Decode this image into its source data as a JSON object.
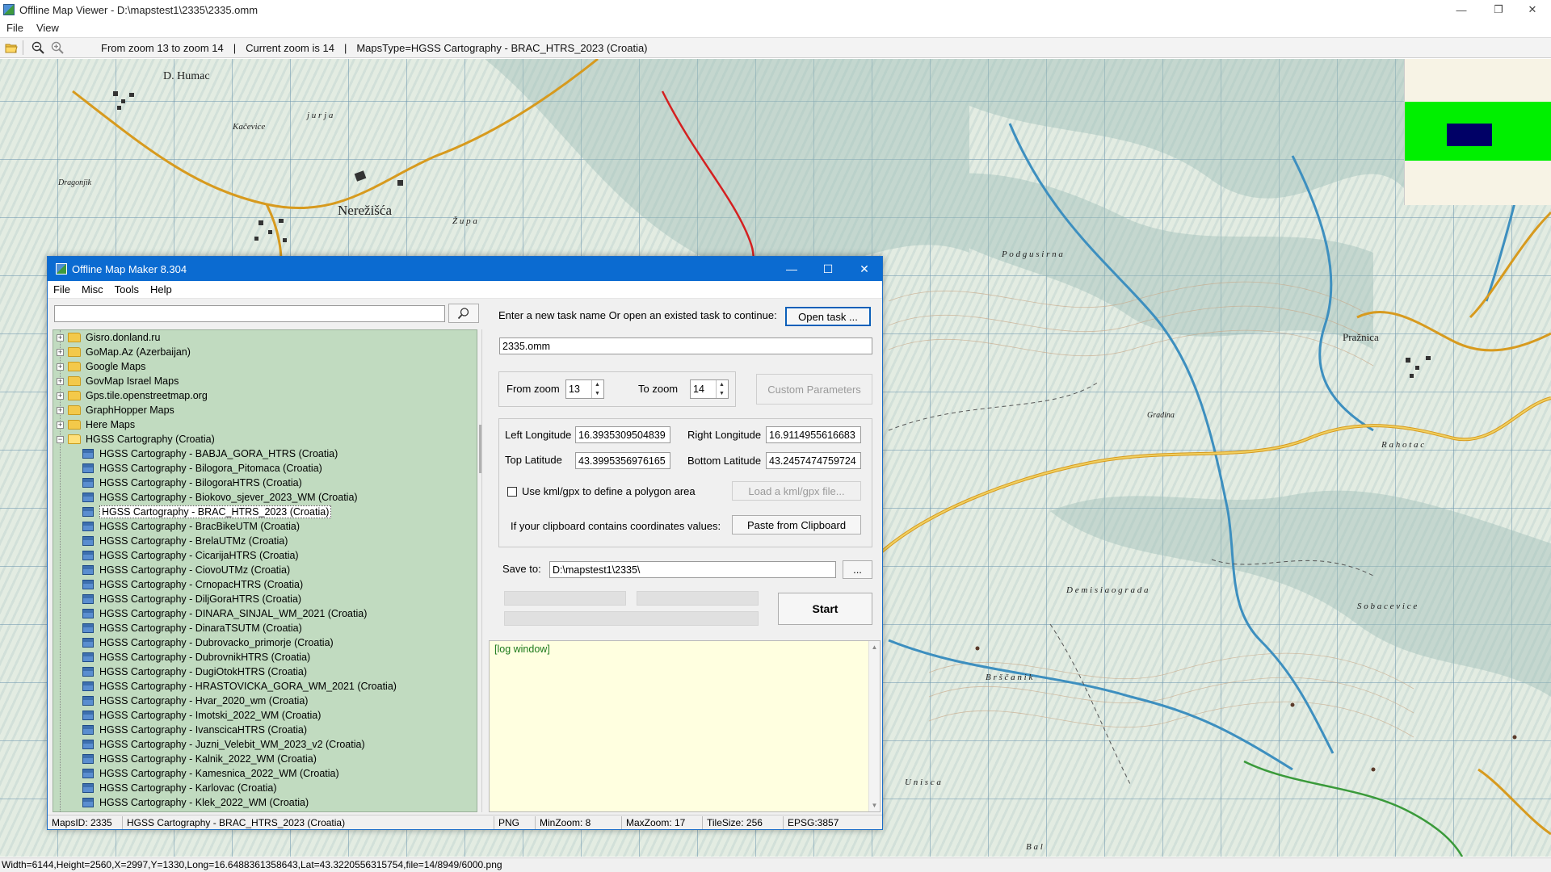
{
  "window": {
    "title": "Offline Map Viewer - D:\\mapstest1\\2335\\2335.omm",
    "controls": {
      "minimize": "—",
      "restore": "❐",
      "close": "✕"
    }
  },
  "menu": [
    "File",
    "View"
  ],
  "toolbar": {
    "zoom_range": "From zoom 13 to zoom 14",
    "current_zoom": "Current zoom is 14",
    "maps_type": "MapsType=HGSS Cartography - BRAC_HTRS_2023 (Croatia)",
    "separator": "|"
  },
  "map": {
    "labels": {
      "humac": "D. Humac",
      "nerezisca": "Nerežišća",
      "praznica": "Pražnica",
      "kacevice": "Kačevice",
      "dragonjik": "Dragonjik",
      "jurja": "j u r j a",
      "zupa": "Ž u p a",
      "podgusirna": "P o d g u s i r n a",
      "demisia": "D e m i s i a   o g r a d a",
      "brscanik": "B r š č a n i k",
      "unisca": "U n i s c a",
      "sobacevice": "S o b a c e v i c e",
      "rahotac": "R a h o t a c",
      "gradina": "Gradina",
      "bal": "B a l"
    }
  },
  "status": "Width=6144,Height=2560,X=2997,Y=1330,Long=16.6488361358643,Lat=43.3220556315754,file=14/8949/6000.png",
  "dialog": {
    "title": "Offline Map Maker 8.304",
    "menu": [
      "File",
      "Misc",
      "Tools",
      "Help"
    ],
    "search_value": "",
    "tree": {
      "folders": [
        {
          "label": "Gisro.donland.ru",
          "expanded": false
        },
        {
          "label": "GoMap.Az (Azerbaijan)",
          "expanded": false
        },
        {
          "label": "Google Maps",
          "expanded": false
        },
        {
          "label": "GovMap Israel Maps",
          "expanded": false
        },
        {
          "label": "Gps.tile.openstreetmap.org",
          "expanded": false
        },
        {
          "label": "GraphHopper Maps",
          "expanded": false
        },
        {
          "label": "Here Maps",
          "expanded": false
        },
        {
          "label": "HGSS Cartography (Croatia)",
          "expanded": true
        }
      ],
      "children": [
        "HGSS Cartography - BABJA_GORA_HTRS (Croatia)",
        "HGSS Cartography - Bilogora_Pitomaca (Croatia)",
        "HGSS Cartography - BilogoraHTRS (Croatia)",
        "HGSS Cartography - Biokovo_sjever_2023_WM (Croatia)",
        "HGSS Cartography - BRAC_HTRS_2023 (Croatia)",
        "HGSS Cartography - BracBikeUTM (Croatia)",
        "HGSS Cartography - BrelaUTMz (Croatia)",
        "HGSS Cartography - CicarijaHTRS (Croatia)",
        "HGSS Cartography - CiovoUTMz (Croatia)",
        "HGSS Cartography - CrnopacHTRS (Croatia)",
        "HGSS Cartography - DiljGoraHTRS (Croatia)",
        "HGSS Cartography - DINARA_SINJAL_WM_2021 (Croatia)",
        "HGSS Cartography - DinaraTSUTM (Croatia)",
        "HGSS Cartography - Dubrovacko_primorje (Croatia)",
        "HGSS Cartography - DubrovnikHTRS (Croatia)",
        "HGSS Cartography - DugiOtokHTRS (Croatia)",
        "HGSS Cartography - HRASTOVICKA_GORA_WM_2021 (Croatia)",
        "HGSS Cartography - Hvar_2020_wm (Croatia)",
        "HGSS Cartography - Imotski_2022_WM (Croatia)",
        "HGSS Cartography - IvanscicaHTRS (Croatia)",
        "HGSS Cartography - Juzni_Velebit_WM_2023_v2 (Croatia)",
        "HGSS Cartography - Kalnik_2022_WM (Croatia)",
        "HGSS Cartography - Kamesnica_2022_WM (Croatia)",
        "HGSS Cartography - Karlovac (Croatia)",
        "HGSS Cartography - Klek_2022_WM (Croatia)"
      ],
      "selected_index": 4
    },
    "task_prompt": "Enter a new task name Or open an existed task to continue:",
    "open_task_label": "Open task ...",
    "task_name": "2335.omm",
    "from_zoom_label": "From zoom",
    "from_zoom": "13",
    "to_zoom_label": "To zoom",
    "to_zoom": "14",
    "custom_params_label": "Custom Parameters",
    "left_lon_label": "Left Longitude",
    "left_lon": "16.3935309504839",
    "right_lon_label": "Right Longitude",
    "right_lon": "16.9114955616683",
    "top_lat_label": "Top Latitude",
    "top_lat": "43.3995356976165",
    "bottom_lat_label": "Bottom Latitude",
    "bottom_lat": "43.2457474759724",
    "kml_label": "Use kml/gpx to define a polygon area",
    "load_kml_label": "Load a kml/gpx file...",
    "clipboard_label": "If your clipboard contains coordinates values:",
    "paste_label": "Paste from Clipboard",
    "save_to_label": "Save to:",
    "save_to": "D:\\mapstest1\\2335\\",
    "browse_label": "...",
    "start_label": "Start",
    "log_text": "[log window]",
    "status": {
      "maps_id": "MapsID: 2335",
      "maps_name": "HGSS Cartography - BRAC_HTRS_2023 (Croatia)",
      "format": "PNG",
      "min_zoom": "MinZoom: 8",
      "max_zoom": "MaxZoom: 17",
      "tile_size": "TileSize: 256",
      "epsg": "EPSG:3857"
    }
  }
}
